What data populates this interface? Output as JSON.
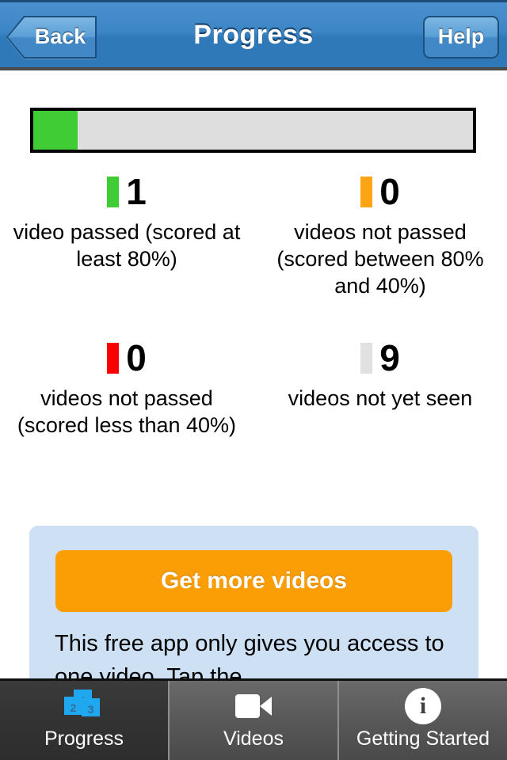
{
  "navbar": {
    "back_label": "Back",
    "title": "Progress",
    "help_label": "Help"
  },
  "progress": {
    "percent_complete": 10,
    "fill_color": "#3fcc35",
    "track_color": "#dedede"
  },
  "stats": [
    {
      "count": "1",
      "label": "video passed (scored at least 80%)",
      "color": "#3fcc35",
      "swatch_name": "green-swatch"
    },
    {
      "count": "0",
      "label": "videos not passed (scored between 80% and 40%)",
      "color": "#fba415",
      "swatch_name": "orange-swatch"
    },
    {
      "count": "0",
      "label": "videos not passed (scored less than 40%)",
      "color": "#fb0000",
      "swatch_name": "red-swatch"
    },
    {
      "count": "9",
      "label": "videos not yet seen",
      "color": "#e1e1e1",
      "swatch_name": "gray-swatch"
    }
  ],
  "promo": {
    "button_label": "Get more videos",
    "button_color": "#fb9e06",
    "box_color": "#cde0f4",
    "body_text": "This free app only gives you access to one video.  Tap the"
  },
  "tabbar": {
    "tabs": [
      {
        "label": "Progress",
        "icon": "stacked-cards-icon",
        "active": true,
        "card_numbers": [
          "1",
          "2",
          "3"
        ]
      },
      {
        "label": "Videos",
        "icon": "video-camera-icon",
        "active": false
      },
      {
        "label": "Getting Started",
        "icon": "info-circle-icon",
        "active": false
      }
    ]
  }
}
